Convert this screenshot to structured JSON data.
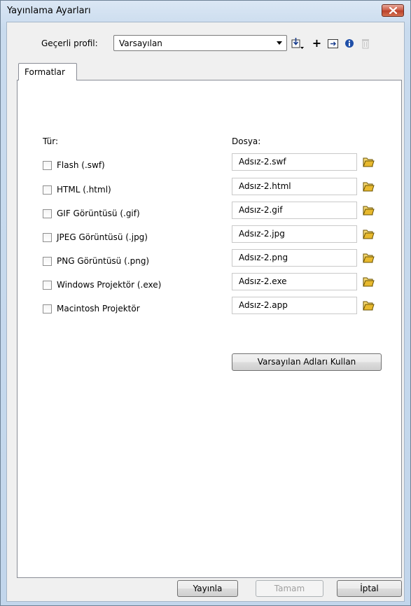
{
  "window": {
    "title": "Yayınlama Ayarları"
  },
  "profile": {
    "label": "Geçerli profil:",
    "selected": "Varsayılan"
  },
  "toolbar": {
    "icons": [
      "import-export-icon",
      "plus-icon",
      "duplicate-icon",
      "info-icon",
      "trash-icon"
    ],
    "plus_glyph": "+"
  },
  "tabs": [
    {
      "label": "Formatlar"
    }
  ],
  "formats": {
    "type_header": "Tür:",
    "file_header": "Dosya:",
    "rows": [
      {
        "label": "Flash  (.swf)",
        "file": "Adsız-2.swf",
        "checked": false
      },
      {
        "label": "HTML (.html)",
        "file": "Adsız-2.html",
        "checked": false
      },
      {
        "label": "GIF Görüntüsü (.gif)",
        "file": "Adsız-2.gif",
        "checked": false
      },
      {
        "label": "JPEG Görüntüsü (.jpg)",
        "file": "Adsız-2.jpg",
        "checked": false
      },
      {
        "label": "PNG Görüntüsü (.png)",
        "file": "Adsız-2.png",
        "checked": false
      },
      {
        "label": "Windows Projektör (.exe)",
        "file": "Adsız-2.exe",
        "checked": false
      },
      {
        "label": "Macintosh Projektör",
        "file": "Adsız-2.app",
        "checked": false
      }
    ],
    "defaults_button": "Varsayılan Adları Kullan"
  },
  "buttons": {
    "publish": "Yayınla",
    "ok": "Tamam",
    "cancel": "İptal"
  },
  "colors": {
    "close_button": "#c9563f",
    "folder": "#e8b92e",
    "info": "#1f4fa8"
  }
}
